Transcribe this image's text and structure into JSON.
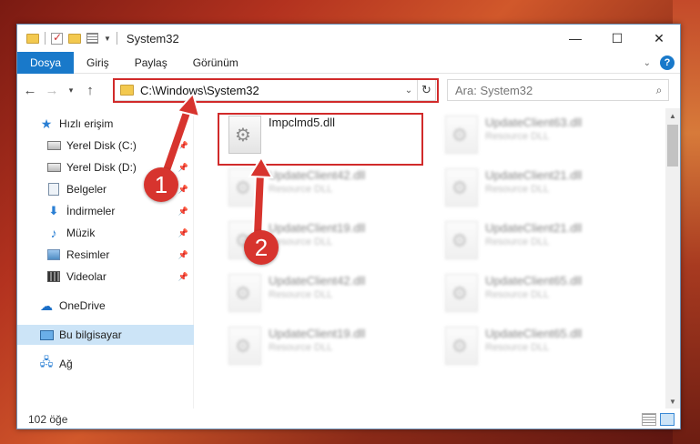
{
  "window": {
    "title": "System32",
    "controls": {
      "minimize": "—",
      "maximize": "☐",
      "close": "✕"
    }
  },
  "ribbon": {
    "tabs": [
      {
        "label": "Dosya",
        "active": true
      },
      {
        "label": "Giriş",
        "active": false
      },
      {
        "label": "Paylaş",
        "active": false
      },
      {
        "label": "Görünüm",
        "active": false
      }
    ],
    "help": "?"
  },
  "address": {
    "path": "C:\\Windows\\System32",
    "highlight_color": "#d12a2a"
  },
  "search": {
    "placeholder": "Ara: System32"
  },
  "sidebar": {
    "items": [
      {
        "label": "Hızlı erişim",
        "icon": "star-icon"
      },
      {
        "label": "Yerel Disk (C:)",
        "icon": "disk-icon",
        "pinned": true
      },
      {
        "label": "Yerel Disk (D:)",
        "icon": "disk-icon",
        "pinned": true
      },
      {
        "label": "Belgeler",
        "icon": "documents-icon",
        "pinned": true
      },
      {
        "label": "İndirmeler",
        "icon": "download-icon",
        "pinned": true
      },
      {
        "label": "Müzik",
        "icon": "music-icon",
        "pinned": true
      },
      {
        "label": "Resimler",
        "icon": "pictures-icon",
        "pinned": true
      },
      {
        "label": "Videolar",
        "icon": "videos-icon",
        "pinned": true
      },
      {
        "label": "OneDrive",
        "icon": "cloud-icon"
      },
      {
        "label": "Bu bilgisayar",
        "icon": "computer-icon",
        "selected": true
      },
      {
        "label": "Ağ",
        "icon": "network-icon"
      }
    ]
  },
  "files": [
    {
      "name": "Impclmd5.dll",
      "type": "",
      "highlighted": true
    },
    {
      "name": "UpdateClient63.dll",
      "type": "Resource DLL",
      "blurred": true
    },
    {
      "name": "UpdateClient42.dll",
      "type": "Resource DLL",
      "blurred": true
    },
    {
      "name": "UpdateClient21.dll",
      "type": "Resource DLL",
      "blurred": true
    },
    {
      "name": "UpdateClient19.dll",
      "type": "Resource DLL",
      "blurred": true
    },
    {
      "name": "UpdateClient21.dll",
      "type": "Resource DLL",
      "blurred": true
    },
    {
      "name": "UpdateClient42.dll",
      "type": "Resource DLL",
      "blurred": true
    },
    {
      "name": "UpdateClient65.dll",
      "type": "Resource DLL",
      "blurred": true
    },
    {
      "name": "UpdateClient19.dll",
      "type": "Resource DLL",
      "blurred": true
    },
    {
      "name": "UpdateClient65.dll",
      "type": "Resource DLL",
      "blurred": true
    }
  ],
  "status": {
    "count": "102 öğe"
  },
  "callouts": [
    {
      "label": "1",
      "color": "#d7342e"
    },
    {
      "label": "2",
      "color": "#d7342e"
    }
  ]
}
